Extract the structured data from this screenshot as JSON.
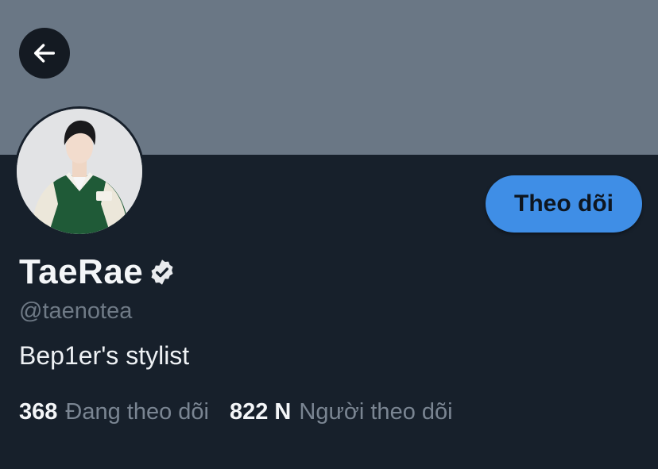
{
  "profile": {
    "name": "TaeRae",
    "handle": "@taenotea",
    "bio": "Bep1er's stylist",
    "verified": true,
    "follow_button_label": "Theo dõi"
  },
  "stats": {
    "following_count": "368",
    "following_label": "Đang theo dõi",
    "followers_count": "822 N",
    "followers_label": "Người theo dõi"
  },
  "icons": {
    "back": "arrow-left-icon",
    "verified": "verified-badge-icon"
  },
  "colors": {
    "banner": "#6a7785",
    "background": "#17202b",
    "follow_button": "#3f8ee6",
    "secondary_text": "#6f7a86"
  }
}
